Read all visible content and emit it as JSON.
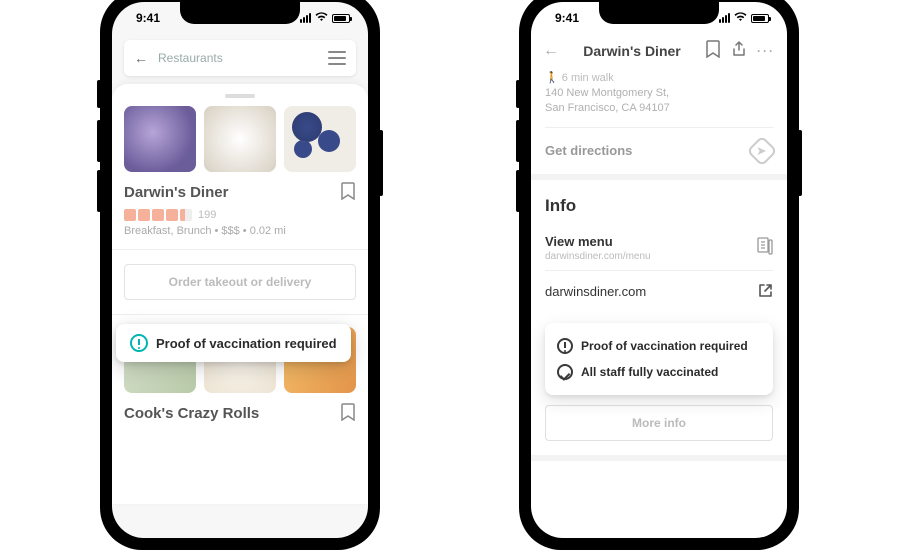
{
  "statusbar": {
    "time": "9:41"
  },
  "phone1": {
    "search": {
      "back_glyph": "←",
      "query": "Restaurants"
    },
    "card1": {
      "name": "Darwin's Diner",
      "reviews": "199",
      "meta": "Breakfast, Brunch  •  $$$  •  0.02 mi"
    },
    "callout": "Proof of vaccination required",
    "order_btn": "Order takeout or delivery",
    "card2": {
      "name": "Cook's Crazy Rolls"
    }
  },
  "phone2": {
    "title": "Darwin's Diner",
    "walk": "6 min walk",
    "address_line1": "140 New Montgomery St,",
    "address_line2": "San Francisco, CA 94107",
    "get_directions": "Get directions",
    "info_heading": "Info",
    "view_menu": "View menu",
    "menu_url": "darwinsdiner.com/menu",
    "website": "darwinsdiner.com",
    "vacc1": "Proof of vaccination required",
    "vacc2": "All staff fully vaccinated",
    "more_info": "More info"
  }
}
